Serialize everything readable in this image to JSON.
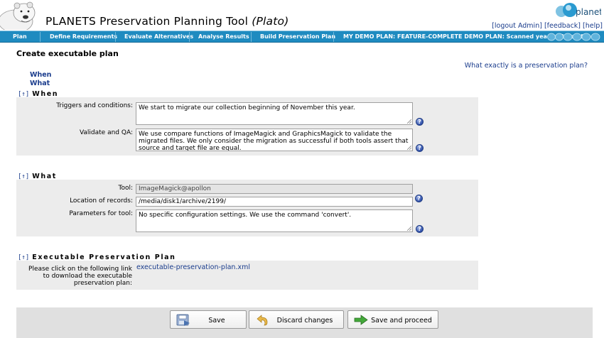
{
  "header": {
    "title_main": "PLANETS Preservation Planning Tool",
    "title_em": "(Plato)",
    "logo_text": "planets",
    "links": [
      "[logout Admin]",
      "[feedback]",
      "[help]"
    ]
  },
  "nav": {
    "items": [
      "Plan",
      "Define Requirements",
      "Evaluate Alternatives",
      "Analyse Results",
      "Build Preservation Plan"
    ],
    "plan_name": "MY DEMO PLAN: FEATURE-COMPLETE DEMO PLAN: Scanned yearbooks archive"
  },
  "page": {
    "title": "Create executable plan",
    "anchor_when": "When",
    "anchor_what": "What",
    "help_link": "What exactly is a preservation plan?"
  },
  "when": {
    "heading": "When",
    "up_marker": "[↑]",
    "triggers_label": "Triggers and conditions:",
    "triggers_value": "We start to migrate our collection beginning of November this year.",
    "validate_label": "Validate and QA:",
    "validate_value": "We use compare functions of ImageMagick and GraphicsMagick to validate the migrated files. We only consider the migration as successful if both tools assert that source and target file are equal."
  },
  "what": {
    "heading": "What",
    "up_marker": "[↑]",
    "tool_label": "Tool:",
    "tool_value": "ImageMagick@apollon",
    "location_label": "Location of records:",
    "location_value": "/media/disk1/archive/2199/",
    "params_label": "Parameters for tool:",
    "params_value": "No specific configuration settings. We use the command 'convert'."
  },
  "executable": {
    "heading": "Executable Preservation Plan",
    "up_marker": "[↑]",
    "instruction": "Please click on the following link to download the executable preservation plan:",
    "file_link": "executable-preservation-plan.xml"
  },
  "footer": {
    "save_label": "Save",
    "discard_label": "Discard changes",
    "proceed_label": "Save and proceed"
  },
  "colors": {
    "nav_blue": "#1f8bc0",
    "link_blue": "#1a3c8c",
    "panel_gray": "#ececec",
    "footer_gray": "#e0e0e0"
  },
  "icons": {
    "help": "question-mark-icon",
    "save": "disk-save-icon",
    "discard": "undo-arrow-icon",
    "proceed": "green-arrow-icon"
  }
}
